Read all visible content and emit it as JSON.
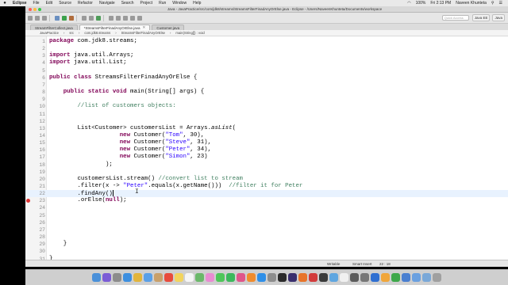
{
  "menubar": {
    "apple": "",
    "items": [
      "Eclipse",
      "File",
      "Edit",
      "Source",
      "Refactor",
      "Navigate",
      "Search",
      "Project",
      "Run",
      "Window",
      "Help"
    ],
    "battery": "100%",
    "time": "Fri 2:13 PM",
    "user": "Naveen Khunteta"
  },
  "window": {
    "title": "Java - JavaPractice/src/com/jdk8/streams/StreamsFilterFinadAnyOrElse.java - Eclipse - /Users/NaveenKhunteta/Documents/workspace"
  },
  "toolbar": {
    "quick_access": "Quick Access",
    "perspectives": [
      "Java EE",
      "Java"
    ]
  },
  "tabs": [
    {
      "label": "StreamFilterCollect.java",
      "active": false
    },
    {
      "label": "*StreamsFilterFinadAnyOrElse.java",
      "active": true
    },
    {
      "label": "Customer.java",
      "active": false
    }
  ],
  "breadcrumb": [
    "JavaPractice",
    "src",
    "com.jdk8.streams",
    "StreamsFilterFinadAnyOrElse",
    "main(String[]) : void"
  ],
  "editor": {
    "current_line": 22,
    "error_line": 23
  },
  "code": [
    [
      {
        "t": "package",
        "c": "kw"
      },
      {
        "t": " com.jdk8.streams;"
      }
    ],
    [],
    [
      {
        "t": "import",
        "c": "kw"
      },
      {
        "t": " java.util.Arrays;"
      }
    ],
    [
      {
        "t": "import",
        "c": "kw"
      },
      {
        "t": " java.util.List;"
      }
    ],
    [],
    [
      {
        "t": "public",
        "c": "kw"
      },
      {
        "t": " "
      },
      {
        "t": "class",
        "c": "kw"
      },
      {
        "t": " StreamsFilterFinadAnyOrElse {"
      }
    ],
    [],
    [
      {
        "t": "    "
      },
      {
        "t": "public",
        "c": "kw"
      },
      {
        "t": " "
      },
      {
        "t": "static",
        "c": "kw"
      },
      {
        "t": " "
      },
      {
        "t": "void",
        "c": "kw"
      },
      {
        "t": " main(String[] args) {"
      }
    ],
    [],
    [
      {
        "t": "        "
      },
      {
        "t": "//list of customers objects:",
        "c": "cmt"
      }
    ],
    [],
    [],
    [
      {
        "t": "        List<Customer> customersList = Arrays."
      },
      {
        "t": "asList",
        "c": "it"
      },
      {
        "t": "("
      }
    ],
    [
      {
        "t": "                    "
      },
      {
        "t": "new",
        "c": "kw"
      },
      {
        "t": " Customer("
      },
      {
        "t": "\"Tom\"",
        "c": "str"
      },
      {
        "t": ", 30),"
      }
    ],
    [
      {
        "t": "                    "
      },
      {
        "t": "new",
        "c": "kw"
      },
      {
        "t": " Customer("
      },
      {
        "t": "\"Steve\"",
        "c": "str"
      },
      {
        "t": ", 31),"
      }
    ],
    [
      {
        "t": "                    "
      },
      {
        "t": "new",
        "c": "kw"
      },
      {
        "t": " Customer("
      },
      {
        "t": "\"Peter\"",
        "c": "str"
      },
      {
        "t": ", 34),"
      }
    ],
    [
      {
        "t": "                    "
      },
      {
        "t": "new",
        "c": "kw"
      },
      {
        "t": " Customer("
      },
      {
        "t": "\"Simon\"",
        "c": "str"
      },
      {
        "t": ", 23)"
      }
    ],
    [
      {
        "t": "                );"
      }
    ],
    [],
    [
      {
        "t": "        customersList.stream() "
      },
      {
        "t": "//convert list to stream",
        "c": "cmt"
      }
    ],
    [
      {
        "t": "        .filter(x -> "
      },
      {
        "t": "\"Peter\"",
        "c": "str"
      },
      {
        "t": ".equals(x.getName()))  "
      },
      {
        "t": "//filter it for Peter",
        "c": "cmt"
      }
    ],
    [
      {
        "t": "        .findAny()"
      }
    ],
    [
      {
        "t": "        .orElse("
      },
      {
        "t": "null",
        "c": "kw"
      },
      {
        "t": ");"
      }
    ],
    [],
    [],
    [],
    [],
    [],
    [
      {
        "t": "    }"
      }
    ],
    [],
    [
      {
        "t": "}"
      }
    ]
  ],
  "status": {
    "writable": "Writable",
    "insert": "Smart Insert",
    "position": "22 : 18"
  },
  "colors": {
    "keyword": "#7f0055",
    "string": "#2a00ff",
    "comment": "#3f7f5f",
    "current_line": "#e8f2fe",
    "error": "#dd3333"
  },
  "dock_icons": [
    "finder-icon",
    "siri-icon",
    "launchpad-icon",
    "safari-icon",
    "chrome-icon",
    "mail-icon",
    "contacts-icon",
    "calendar-icon",
    "notes-icon",
    "reminders-icon",
    "maps-icon",
    "photos-icon",
    "messages-icon",
    "facetime-icon",
    "itunes-icon",
    "ibooks-icon",
    "appstore-icon",
    "preferences-icon",
    "terminal-icon",
    "eclipse-icon",
    "firefox-icon",
    "screenflow-icon",
    "quicktime-icon",
    "preview-icon",
    "textedit-icon",
    "activity-monitor-icon",
    "console-icon",
    "keynote-icon",
    "pages-icon",
    "numbers-icon",
    "xcode-icon",
    "downloads-icon",
    "documents-icon",
    "trash-icon"
  ]
}
